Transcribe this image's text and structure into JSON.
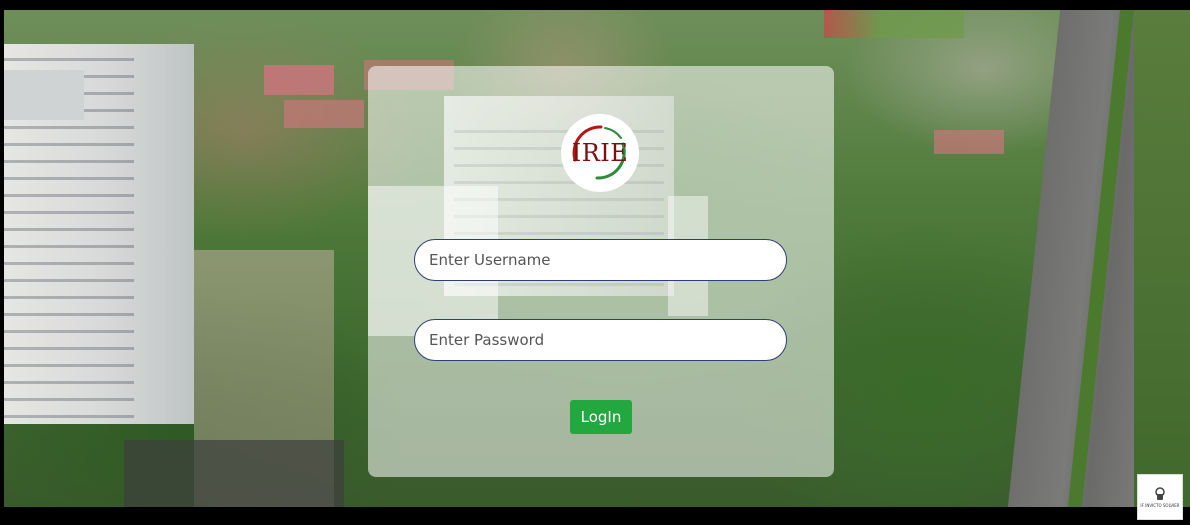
{
  "login": {
    "logo_text": "IRIE",
    "username_placeholder": "Enter Username",
    "password_placeholder": "Enter Password",
    "login_label": "LogIn"
  },
  "corner_badge": {
    "text": "IF INVICTO SOLVIER"
  },
  "colors": {
    "accent_button": "#23a73f",
    "field_border": "#2f3e78",
    "logo_red": "#7a1010",
    "logo_green": "#2f8a3a"
  }
}
